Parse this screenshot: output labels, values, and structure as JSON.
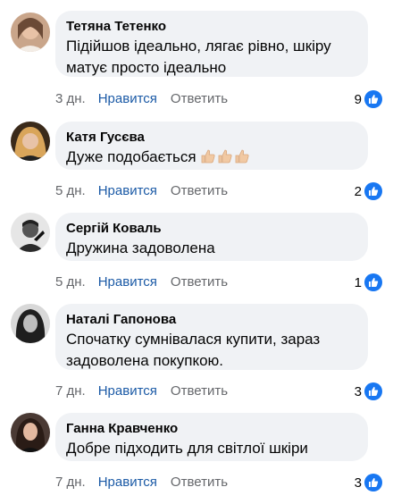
{
  "comments": [
    {
      "author": "Тетяна Тетенко",
      "text": "Підійшов ідеально, лягає рівно, шкіру матує просто ідеально",
      "time": "3 дн.",
      "like": "Нравится",
      "reply": "Ответить",
      "likes": "9"
    },
    {
      "author": "Катя Гусєва",
      "text": "Дуже подобається",
      "emoji": "👍🏼👍🏼👍🏼",
      "time": "5 дн.",
      "like": "Нравится",
      "reply": "Ответить",
      "likes": "2"
    },
    {
      "author": "Сергій Коваль",
      "text": "Дружина задоволена",
      "time": "5 дн.",
      "like": "Нравится",
      "reply": "Ответить",
      "likes": "1"
    },
    {
      "author": "Наталі Гапонова",
      "text": "Спочатку сумнівалася купити, зараз задоволена покупкою.",
      "time": "7 дн.",
      "like": "Нравится",
      "reply": "Ответить",
      "likes": "3"
    },
    {
      "author": "Ганна Кравченко",
      "text": "Добре підходить для світлої шкіри",
      "time": "7 дн.",
      "like": "Нравится",
      "reply": "Ответить",
      "likes": "3"
    }
  ],
  "icons": {
    "reaction": "like-thumb-icon",
    "emoji": "thumbs-up-emoji"
  },
  "colors": {
    "like_link": "#1b5aa6",
    "reaction_badge": "#1877f2",
    "bubble": "#f0f2f5",
    "meta": "#65676b"
  }
}
